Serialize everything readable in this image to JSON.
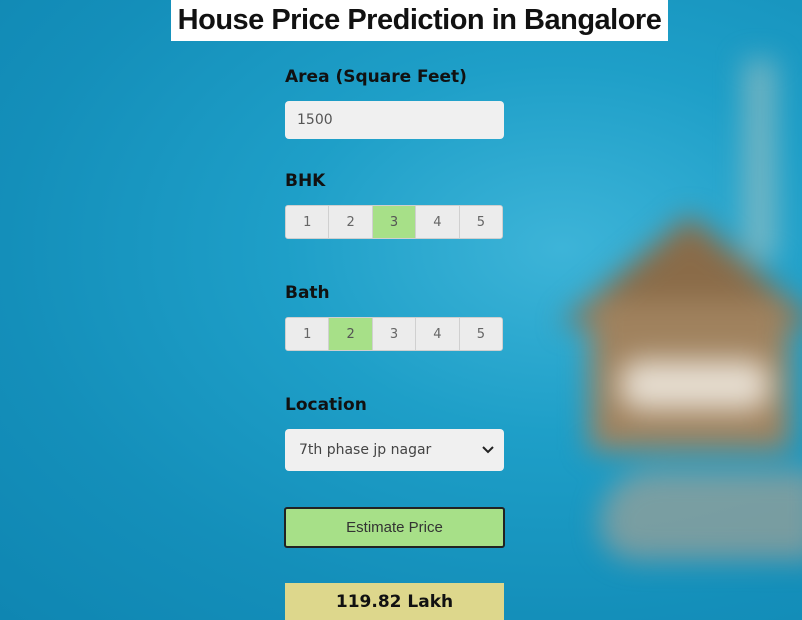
{
  "title": "House Price Prediction in Bangalore",
  "area": {
    "label": "Area (Square Feet)",
    "value": "1500"
  },
  "bhk": {
    "label": "BHK",
    "options": [
      "1",
      "2",
      "3",
      "4",
      "5"
    ],
    "selected": "3"
  },
  "bath": {
    "label": "Bath",
    "options": [
      "1",
      "2",
      "3",
      "4",
      "5"
    ],
    "selected": "2"
  },
  "location": {
    "label": "Location",
    "selected": "7th phase jp nagar"
  },
  "estimate_button": "Estimate Price",
  "result": "119.82 Lakh",
  "colors": {
    "selected_option": "#a7e088",
    "button": "#a7e088",
    "result_bg": "#ddd78c",
    "background": "#1e9fc8"
  },
  "icons": {
    "select_arrow": "chevron-down-icon"
  }
}
